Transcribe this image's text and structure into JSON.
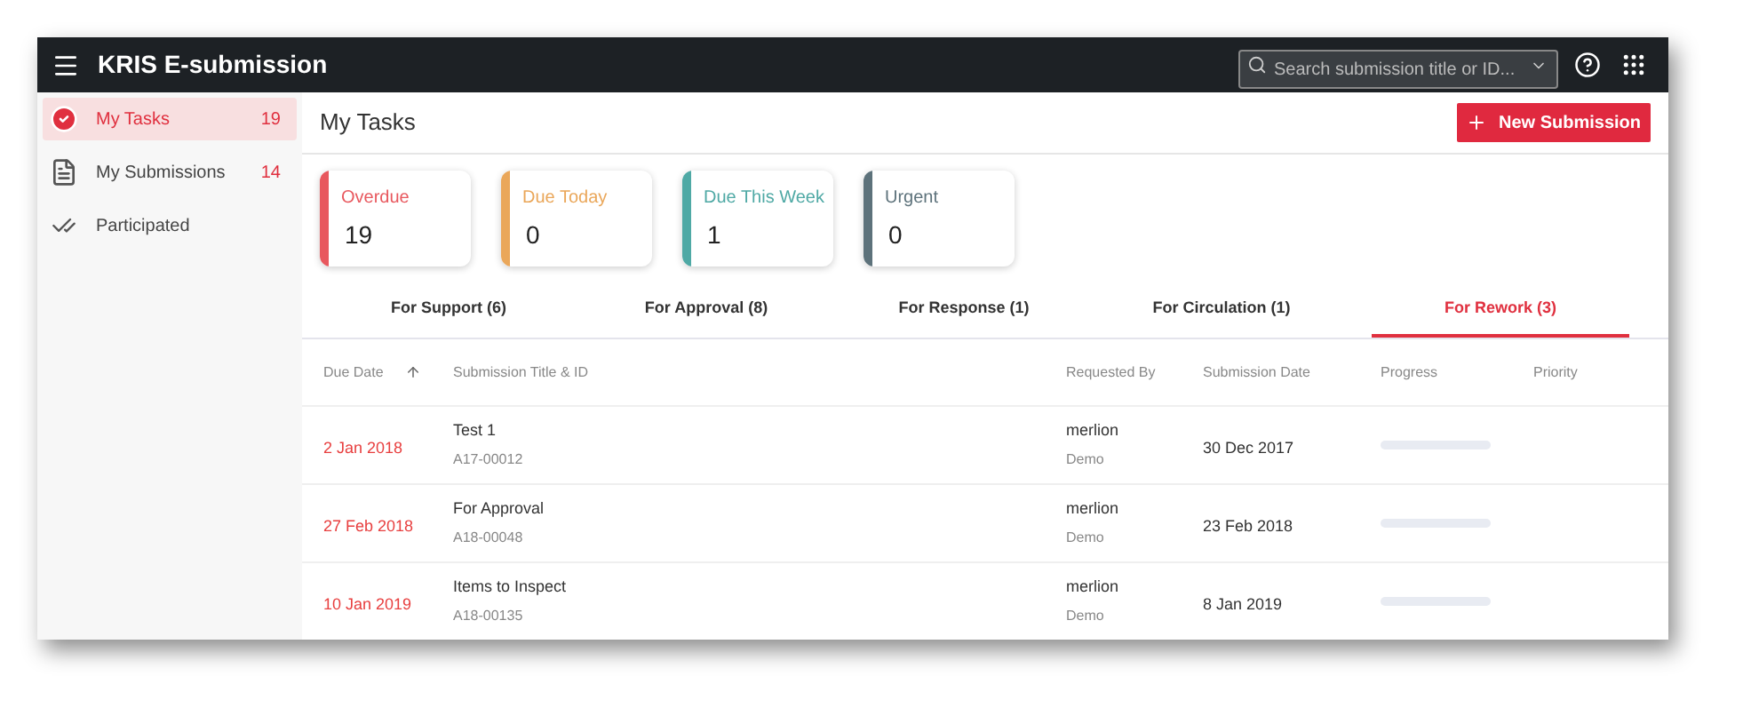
{
  "app_bar": {
    "title": "KRIS E-submission",
    "search": {
      "placeholder": "Search submission title or ID..."
    }
  },
  "sidebar": {
    "items": [
      {
        "kind": "tasks",
        "label": "My Tasks",
        "count": "19",
        "selected": true
      },
      {
        "kind": "submissions",
        "label": "My Submissions",
        "count": "14",
        "selected": false
      },
      {
        "kind": "participated",
        "label": "Participated",
        "selected": false
      }
    ]
  },
  "page": {
    "title": "My Tasks",
    "new_button": "New Submission"
  },
  "summary_cards": [
    {
      "label": "Overdue",
      "value": "19",
      "color": "#e8585e"
    },
    {
      "label": "Due Today",
      "value": "0",
      "color": "#eaa75a"
    },
    {
      "label": "Due This Week",
      "value": "1",
      "color": "#4fa9a5"
    },
    {
      "label": "Urgent",
      "value": "0",
      "color": "#5d727b"
    }
  ],
  "tabs": [
    {
      "label": "For Support (6)",
      "selected": false
    },
    {
      "label": "For Approval (8)",
      "selected": false
    },
    {
      "label": "For Response (1)",
      "selected": false
    },
    {
      "label": "For Circulation (1)",
      "selected": false
    },
    {
      "label": "For Rework (3)",
      "selected": true
    }
  ],
  "table": {
    "columns": [
      {
        "label": "Due Date",
        "sorted": true
      },
      {
        "label": "Submission Title & ID",
        "sorted": false
      },
      {
        "label": "Requested By",
        "sorted": false
      },
      {
        "label": "Submission Date",
        "sorted": false
      },
      {
        "label": "Progress",
        "sorted": false
      },
      {
        "label": "Priority",
        "sorted": false
      }
    ],
    "rows": [
      {
        "due_date": "2 Jan 2018",
        "title": "Test 1",
        "id": "A17-00012",
        "requested_by": "merlion",
        "requester_group": "Demo",
        "submission_date": "30 Dec 2017",
        "level": 0
      },
      {
        "due_date": "27 Feb 2018",
        "title": "For Approval",
        "id": "A18-00048",
        "requested_by": "merlion",
        "requester_group": "Demo",
        "submission_date": "23 Feb 2018",
        "level": 0
      },
      {
        "due_date": "10 Jan 2019",
        "title": "Items to Inspect",
        "id": "A18-00135",
        "requested_by": "merlion",
        "requester_group": "Demo",
        "submission_date": "8 Jan 2019",
        "level": 0
      }
    ]
  }
}
